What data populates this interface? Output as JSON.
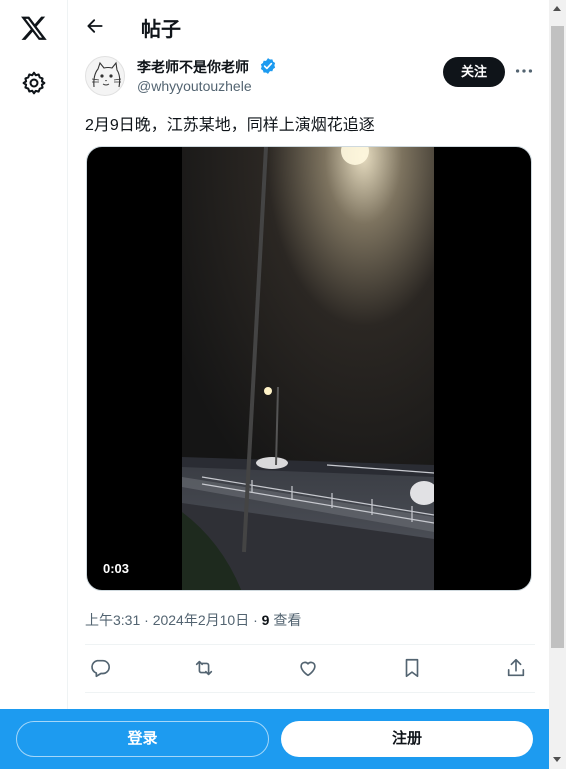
{
  "nav": {
    "logo_icon": "x-logo-icon",
    "settings_icon": "gear-icon"
  },
  "header": {
    "title": "帖子",
    "back_icon": "back-arrow-icon"
  },
  "post": {
    "author": {
      "display_name": "李老师不是你老师",
      "handle": "@whyyoutouzhele",
      "verified": true
    },
    "follow_label": "关注",
    "more_icon": "more-dots-icon",
    "text": "2月9日晚，江苏某地，同样上演烟花追逐",
    "video": {
      "duration": "0:03"
    },
    "meta": {
      "time_date": "上午3:31 · 2024年2月10日 · ",
      "views_count": "9",
      "views_label": " 查看"
    },
    "actions": [
      {
        "icon": "reply-icon"
      },
      {
        "icon": "repost-icon"
      },
      {
        "icon": "like-icon"
      },
      {
        "icon": "bookmark-icon"
      },
      {
        "icon": "share-icon"
      }
    ]
  },
  "footer": {
    "login_label": "登录",
    "signup_label": "注册"
  },
  "colors": {
    "accent": "#1d9bf0",
    "text": "#0f1419",
    "secondary": "#536471"
  }
}
